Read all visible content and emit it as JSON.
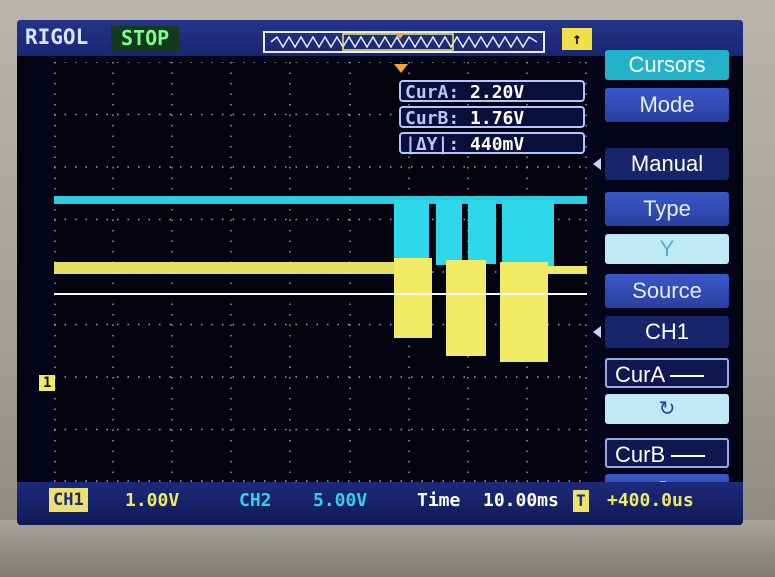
{
  "header": {
    "brand": "RIGOL",
    "run_state": "STOP",
    "trigger_badge": "↑"
  },
  "cursor_readouts": [
    {
      "label": "CurA:",
      "value": "2.20V"
    },
    {
      "label": "CurB:",
      "value": "1.76V"
    },
    {
      "label": "|ΔY|:",
      "value": "440mV"
    }
  ],
  "menu": {
    "title": "Cursors",
    "mode_label": "Mode",
    "mode_value": "Manual",
    "type_label": "Type",
    "type_value": "Y",
    "source_label": "Source",
    "source_value": "CH1",
    "cur_a_label": "CurA",
    "cur_b_label": "CurB"
  },
  "status_bar": {
    "ch1_label": "CH1",
    "ch1_scale": "1.00V",
    "ch2_label": "CH2",
    "ch2_scale": "5.00V",
    "time_label": "Time",
    "time_scale": "10.00ms",
    "trigger_offset": "+400.0us"
  },
  "markers": {
    "ch1_ground": "1"
  },
  "colors": {
    "ch1": "#f1ea63",
    "ch2": "#2fd7ea",
    "cursor": "#ffffff",
    "menu_title": "#22b3c8",
    "screen_bg": "#05051a"
  }
}
